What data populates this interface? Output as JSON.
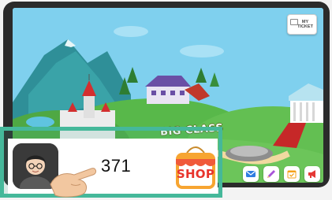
{
  "header": {
    "ticket_label": "MY TICKET"
  },
  "map": {
    "location_label": "BIG CLASS"
  },
  "wallet": {
    "coins": "371",
    "shop_label": "SHOP"
  },
  "toolbar": {
    "buttons": [
      {
        "icon": "mail-icon"
      },
      {
        "icon": "pencil-icon"
      },
      {
        "icon": "calendar-check-icon"
      },
      {
        "icon": "megaphone-icon"
      }
    ]
  },
  "colors": {
    "highlight": "#45b89a",
    "shop_red": "#e8342c",
    "sky": "#7fd0ee",
    "frame": "#2b2b2b"
  }
}
